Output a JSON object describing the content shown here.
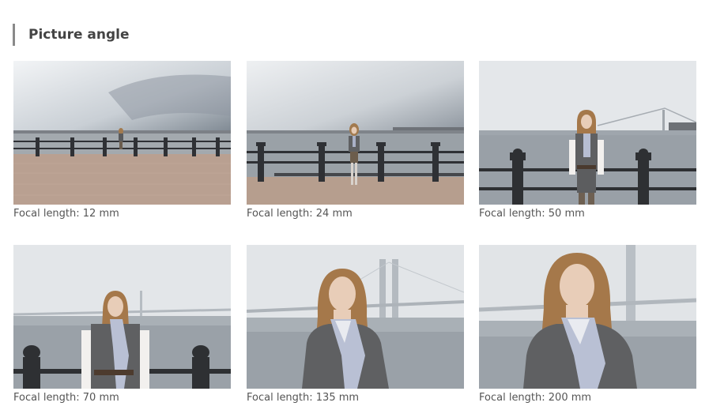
{
  "section": {
    "title": "Picture angle"
  },
  "photos": [
    {
      "caption": "Focal length: 12 mm"
    },
    {
      "caption": "Focal length: 24 mm"
    },
    {
      "caption": "Focal length: 50 mm"
    },
    {
      "caption": "Focal length: 70 mm"
    },
    {
      "caption": "Focal length: 135 mm"
    },
    {
      "caption": "Focal length: 200 mm"
    }
  ],
  "colors": {
    "sky": "#dfe3e7",
    "sea": "#8e969c",
    "pavement": "#b59c8c",
    "railing": "#3b3d40",
    "hair": "#a5784a",
    "coat": "#5f6062"
  }
}
